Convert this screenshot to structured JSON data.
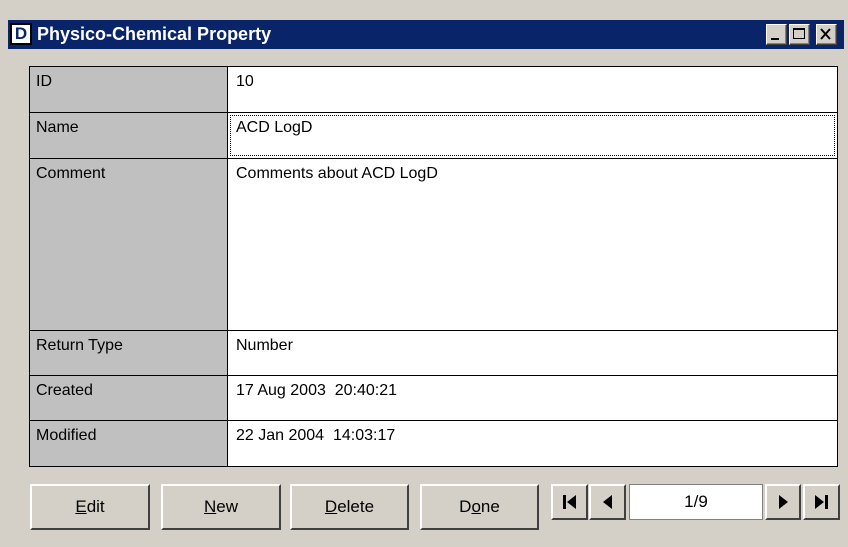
{
  "window": {
    "title": "Physico-Chemical Property",
    "icon_letter": "D"
  },
  "title_buttons": {
    "minimize": "minimize-icon",
    "maximize": "maximize-icon",
    "close": "close-icon"
  },
  "fields": [
    {
      "label": "ID",
      "value": "10"
    },
    {
      "label": "Name",
      "value": "ACD LogD"
    },
    {
      "label": "Comment",
      "value": "Comments about ACD LogD"
    },
    {
      "label": "Return Type",
      "value": "Number"
    },
    {
      "label": "Created",
      "value": "17 Aug 2003  20:40:21"
    },
    {
      "label": "Modified",
      "value": "22 Jan 2004  14:03:17"
    }
  ],
  "buttons": {
    "edit": {
      "mnemonic": "E",
      "rest": "dit"
    },
    "new": {
      "mnemonic": "N",
      "rest": "ew"
    },
    "delete": {
      "mnemonic": "D",
      "rest": "elete"
    },
    "done": {
      "pre": "D",
      "mnemonic": "o",
      "rest": "ne"
    }
  },
  "navigator": {
    "position": "1/9",
    "icons": [
      "first-record-icon",
      "prev-record-icon",
      "next-record-icon",
      "last-record-icon"
    ]
  },
  "colors": {
    "titlebar": "#0a246a",
    "face": "#d4d0c8",
    "label_bg": "#c0c0c0"
  }
}
